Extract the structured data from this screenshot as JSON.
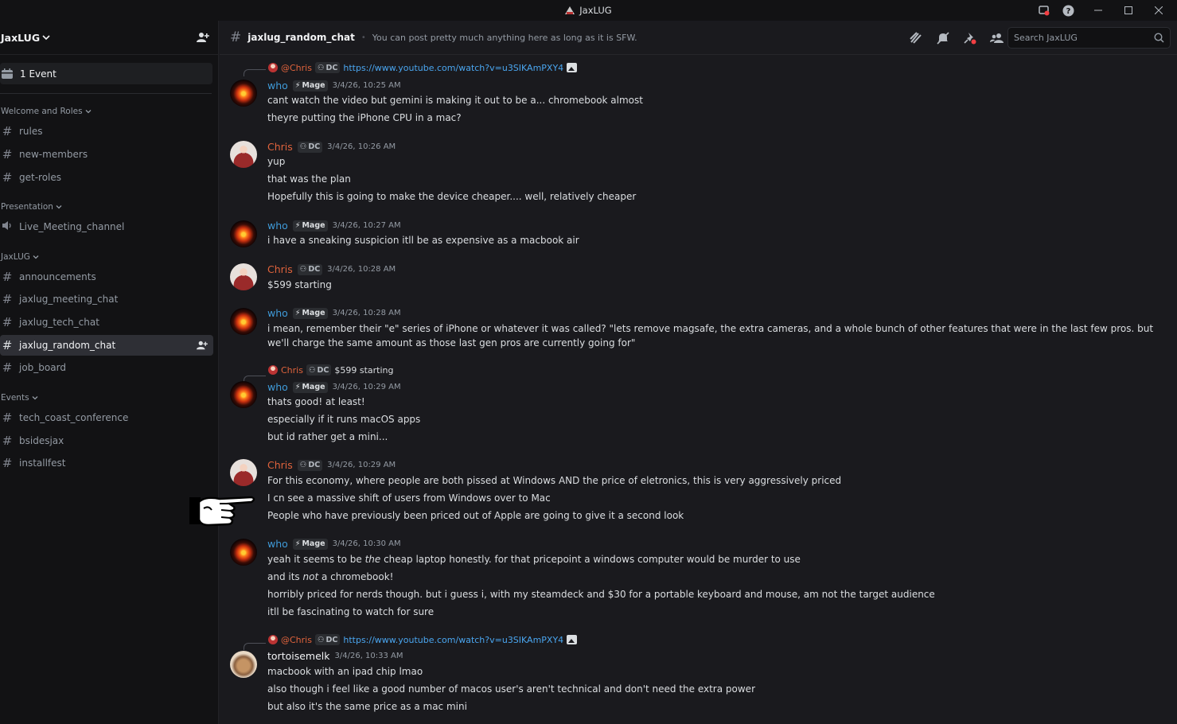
{
  "window": {
    "title": "JaxLUG"
  },
  "sidebar": {
    "server_name": "JaxLUG",
    "event_label": "1 Event",
    "categories": [
      {
        "label": "Welcome and Roles",
        "channels": [
          "rules",
          "new-members",
          "get-roles"
        ]
      },
      {
        "label": "Presentation",
        "channels": [
          "Live_Meeting_channel"
        ]
      },
      {
        "label": "JaxLUG",
        "channels": [
          "announcements",
          "jaxlug_meeting_chat",
          "jaxlug_tech_chat",
          "jaxlug_random_chat",
          "job_board"
        ]
      },
      {
        "label": "Events",
        "channels": [
          "tech_coast_conference",
          "bsidesjax",
          "installfest"
        ]
      }
    ],
    "active_channel": "jaxlug_random_chat"
  },
  "header": {
    "channel": "jaxlug_random_chat",
    "topic": "You can post pretty much anything here as long as it is SFW.",
    "search_placeholder": "Search JaxLUG"
  },
  "messages": [
    {
      "reply": {
        "name": "@Chris",
        "tag": "DC",
        "text": "https://www.youtube.com/watch?v=u3SIKAmPXY4",
        "is_link": true,
        "has_image": true
      },
      "author": "who",
      "role_tag": "Mage",
      "timestamp": "3/4/26, 10:25 AM",
      "lines": [
        "cant watch the video but gemini is making it out to be a... chromebook almost",
        "theyre putting the iPhone CPU in a mac?"
      ]
    },
    {
      "author": "Chris",
      "role_tag": "DC",
      "timestamp": "3/4/26, 10:26 AM",
      "lines": [
        "yup",
        "that was the plan",
        "Hopefully this is going to make the device cheaper.... well, relatively cheaper"
      ]
    },
    {
      "author": "who",
      "role_tag": "Mage",
      "timestamp": "3/4/26, 10:27 AM",
      "lines": [
        "i have a sneaking suspicion itll be as expensive as a macbook air"
      ]
    },
    {
      "author": "Chris",
      "role_tag": "DC",
      "timestamp": "3/4/26, 10:28 AM",
      "lines": [
        "$599 starting"
      ]
    },
    {
      "author": "who",
      "role_tag": "Mage",
      "timestamp": "3/4/26, 10:28 AM",
      "lines": [
        "i mean, remember their \"e\" series of iPhone or whatever it was called? \"lets remove magsafe, the extra cameras, and a whole bunch of other features that were in the last few pros. but we'll charge the same amount as those last gen pros are currently going for\""
      ]
    },
    {
      "reply": {
        "name": "Chris",
        "tag": "DC",
        "text": "$599 starting",
        "is_link": false,
        "has_image": false
      },
      "author": "who",
      "role_tag": "Mage",
      "timestamp": "3/4/26, 10:29 AM",
      "lines": [
        "thats good! at least!",
        "especially if it runs macOS apps",
        "but id rather get a mini..."
      ]
    },
    {
      "author": "Chris",
      "role_tag": "DC",
      "timestamp": "3/4/26, 10:29 AM",
      "lines": [
        "For this economy, where people are both pissed at Windows AND the price of eletronics, this is very aggressively priced",
        "I cn see a massive shift of users from Windows over to Mac",
        "People who have previously been priced out of Apple are going to give it a second look"
      ]
    },
    {
      "author": "who",
      "role_tag": "Mage",
      "timestamp": "3/4/26, 10:30 AM",
      "lines_rich": [
        [
          "yeah it seems to be ",
          "the",
          " cheap laptop honestly. for that pricepoint a windows computer would be murder to use"
        ],
        [
          "and its ",
          "not",
          " a chromebook!"
        ]
      ],
      "lines": [
        "horribly priced for nerds though. but i guess i, with my steamdeck and $30 for a portable keyboard and mouse, am not the target audience",
        "itll be fascinating to watch for sure"
      ]
    },
    {
      "reply": {
        "name": "@Chris",
        "tag": "DC",
        "text": "https://www.youtube.com/watch?v=u3SIKAmPXY4",
        "is_link": true,
        "has_image": true
      },
      "author": "tortoisemelk",
      "timestamp": "3/4/26, 10:33 AM",
      "lines": [
        "macbook with an ipad chip lmao",
        "also though i feel like a good number of macos user's aren't technical and don't need the extra power",
        "but also it's the same price as a mac mini"
      ]
    }
  ]
}
